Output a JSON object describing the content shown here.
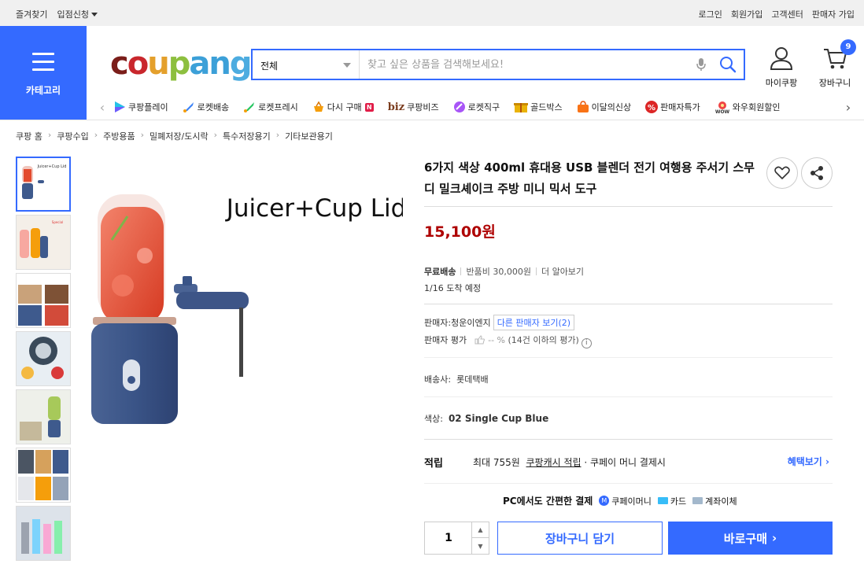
{
  "topbar": {
    "favorites": "즐겨찾기",
    "seller_apply": "입점신청",
    "login": "로그인",
    "signup": "회원가입",
    "customer_center": "고객센터",
    "seller_signup": "판매자 가입"
  },
  "header": {
    "category_label": "카테고리",
    "logo": [
      "c",
      "o",
      "u",
      "p",
      "a",
      "n",
      "g"
    ],
    "search_category": "전체",
    "search_placeholder": "찾고 싶은 상품을 검색해보세요!",
    "my_coupang": "마이쿠팡",
    "cart_label": "장바구니",
    "cart_count": "9"
  },
  "nav": [
    {
      "label": "쿠팡플레이",
      "color": "#8b5cf6"
    },
    {
      "label": "로켓배송",
      "color": "#3b82f6"
    },
    {
      "label": "로켓프레시",
      "color": "#22c55e"
    },
    {
      "label": "다시 구매",
      "color": "#f59e0b",
      "badge": "N"
    },
    {
      "label": "쿠팡비즈",
      "prefix": "biz"
    },
    {
      "label": "로켓직구",
      "color": "#a855f7"
    },
    {
      "label": "골드박스",
      "color": "#eab308"
    },
    {
      "label": "이달의신상",
      "color": "#f97316"
    },
    {
      "label": "판매자특가",
      "color": "#dc2626"
    },
    {
      "label": "와우회원할인",
      "color": "#ef4444"
    }
  ],
  "breadcrumb": [
    "쿠팡 홈",
    "쿠팡수입",
    "주방용품",
    "밀폐저장/도시락",
    "특수저장용기",
    "기타보관용기"
  ],
  "product": {
    "image_caption": "Juicer+Cup Lid",
    "title": "6가지 색상 400ml 휴대용 USB 블렌더 전기 여행용 주서기 스무디 밀크셰이크 주방 미니 믹서 도구",
    "price": "15,100원",
    "free_shipping": "무료배송",
    "return_fee": "반품비 30,000원",
    "more": "더 알아보기",
    "arrival": "1/16 도착 예정",
    "seller_label": "판매자:",
    "seller_name": "청운이엔지",
    "other_sellers": "다른 판매자 보기(2)",
    "seller_rating_label": "판매자 평가",
    "seller_rating_value": "-- %",
    "seller_rating_note": "(14건 이하의 평가)",
    "carrier_label": "배송사:",
    "carrier": "롯데택배",
    "option_label": "색상:",
    "option_value": "02 Single Cup Blue",
    "reward_label": "적립",
    "reward_max": "최대 755원",
    "reward_cash": "쿠팡캐시 적립",
    "reward_pay": "· 쿠페이 머니 결제시",
    "benefit_link": "혜택보기",
    "pc_pay": "PC에서도 간편한 결제",
    "pay_money": "쿠페이머니",
    "pay_card": "카드",
    "pay_account": "계좌이체",
    "quantity": "1",
    "add_to_cart": "장바구니 담기",
    "buy_now": "바로구매"
  }
}
